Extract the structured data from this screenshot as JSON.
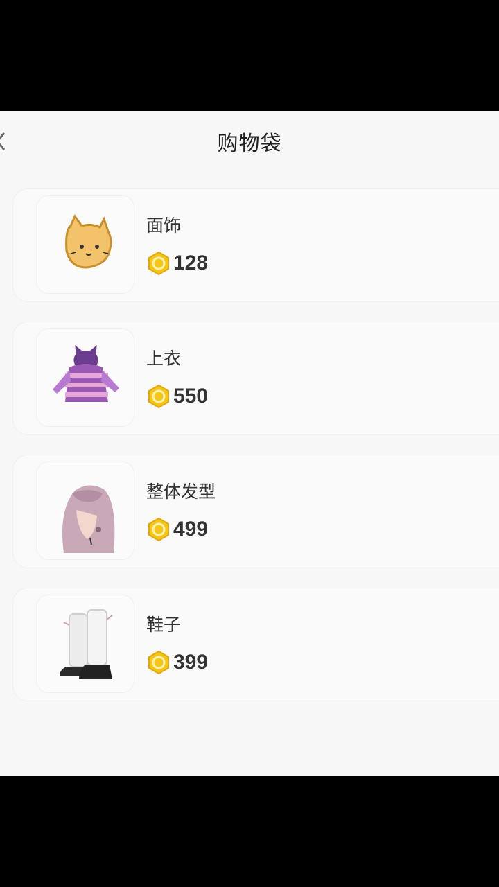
{
  "header": {
    "title": "购物袋",
    "back_icon": "chevron-left-icon"
  },
  "items": [
    {
      "name": "面饰",
      "price": "128",
      "icon": "cat-face-mask-icon"
    },
    {
      "name": "上衣",
      "price": "550",
      "icon": "purple-striped-hoodie-icon"
    },
    {
      "name": "整体发型",
      "price": "499",
      "icon": "pink-long-hair-icon"
    },
    {
      "name": "鞋子",
      "price": "399",
      "icon": "white-boots-icon"
    }
  ],
  "colors": {
    "coin": "#f5c518",
    "coin_inner": "#e3a90c",
    "background": "#f7f7f7"
  }
}
